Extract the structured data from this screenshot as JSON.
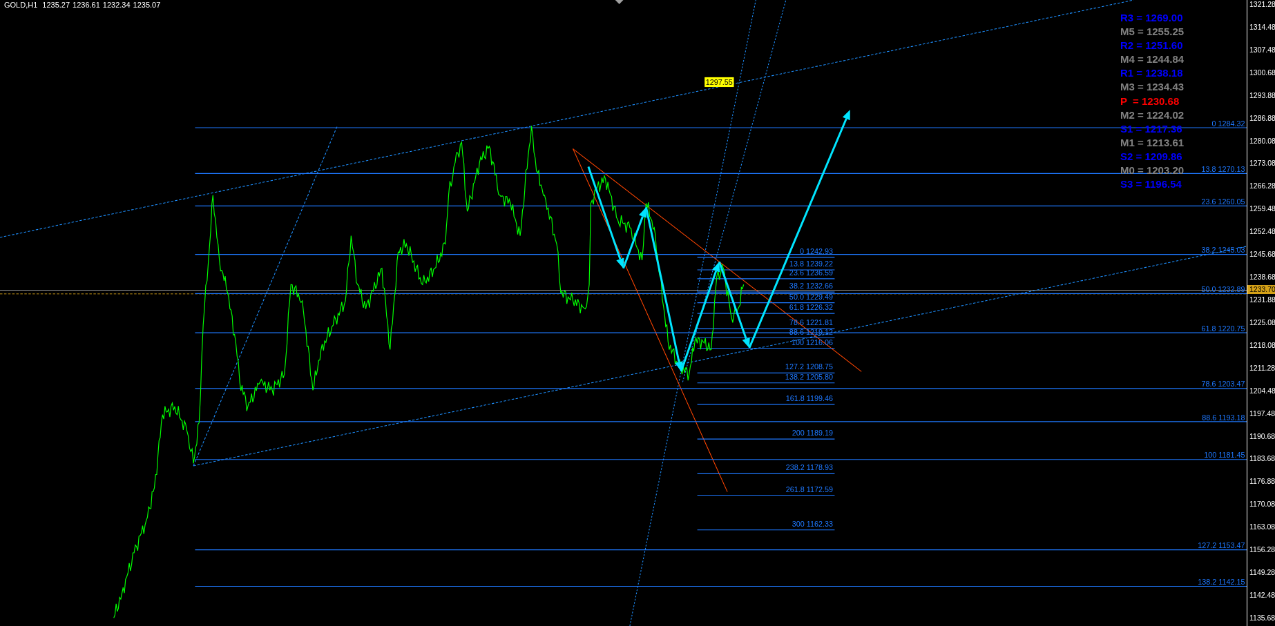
{
  "header": {
    "symbol": "GOLD,H1",
    "prices": [
      "1235.27",
      "1236.61",
      "1232.34",
      "1235.07"
    ]
  },
  "pivot_levels": [
    {
      "text": "R3 = 1269.00",
      "color": "#0000ff"
    },
    {
      "text": "M5 = 1255.25",
      "color": "#808080"
    },
    {
      "text": "R2 = 1251.60",
      "color": "#0000ff"
    },
    {
      "text": "M4 = 1244.84",
      "color": "#808080"
    },
    {
      "text": "R1 = 1238.18",
      "color": "#0000ff"
    },
    {
      "text": "M3 = 1234.43",
      "color": "#808080"
    },
    {
      "text": "P  = 1230.68",
      "color": "#ff0000"
    },
    {
      "text": "M2 = 1224.02",
      "color": "#808080"
    },
    {
      "text": "S1 = 1217.36",
      "color": "#0000ff"
    },
    {
      "text": "M1 = 1213.61",
      "color": "#808080"
    },
    {
      "text": "S2 = 1209.86",
      "color": "#0000ff"
    },
    {
      "text": "M0 = 1203.20",
      "color": "#808080"
    },
    {
      "text": "S3 = 1196.54",
      "color": "#0000ff"
    }
  ],
  "object_label": "1297.55",
  "outer_fibonacci": [
    {
      "label": "0 1284.32"
    },
    {
      "label": "13.8 1270.13"
    },
    {
      "label": "23.6 1260.05"
    },
    {
      "label": "38.2 1245.03"
    },
    {
      "label": "50.0 1232.89"
    },
    {
      "label": "61.8 1220.75"
    },
    {
      "label": "78.6 1203.47"
    },
    {
      "label": "88.6 1193.18"
    },
    {
      "label": "100 1181.45"
    },
    {
      "label": "127.2 1153.47"
    },
    {
      "label": "138.2 1142.15"
    }
  ],
  "inner_fibonacci": [
    {
      "label": "0 1242.93"
    },
    {
      "label": "13.8 1239.22"
    },
    {
      "label": "23.6 1236.59"
    },
    {
      "label": "38.2 1232.66"
    },
    {
      "label": "50.0 1229.49"
    },
    {
      "label": "61.8 1226.32"
    },
    {
      "label": "78.6 1221.81"
    },
    {
      "label": "88.6 1219.12"
    },
    {
      "label": "100 1216.06"
    },
    {
      "label": "127.2 1208.75"
    },
    {
      "label": "138.2 1205.80"
    },
    {
      "label": "161.8 1199.46"
    },
    {
      "label": "200 1189.19"
    },
    {
      "label": "238.2 1178.93"
    },
    {
      "label": "261.8 1172.59"
    },
    {
      "label": "300 1162.33"
    }
  ],
  "price_axis": {
    "ticks": [
      "1321.28",
      "1314.48",
      "1307.48",
      "1300.68",
      "1293.88",
      "1286.88",
      "1280.08",
      "1273.08",
      "1266.28",
      "1259.48",
      "1252.48",
      "1245.68",
      "1238.68",
      "1231.88",
      "1225.08",
      "1218.08",
      "1211.28",
      "1204.48",
      "1197.48",
      "1190.68",
      "1183.68",
      "1176.88",
      "1170.08",
      "1163.08",
      "1156.28",
      "1149.28",
      "1142.48",
      "1135.68"
    ],
    "current_price": "1233.70"
  }
}
